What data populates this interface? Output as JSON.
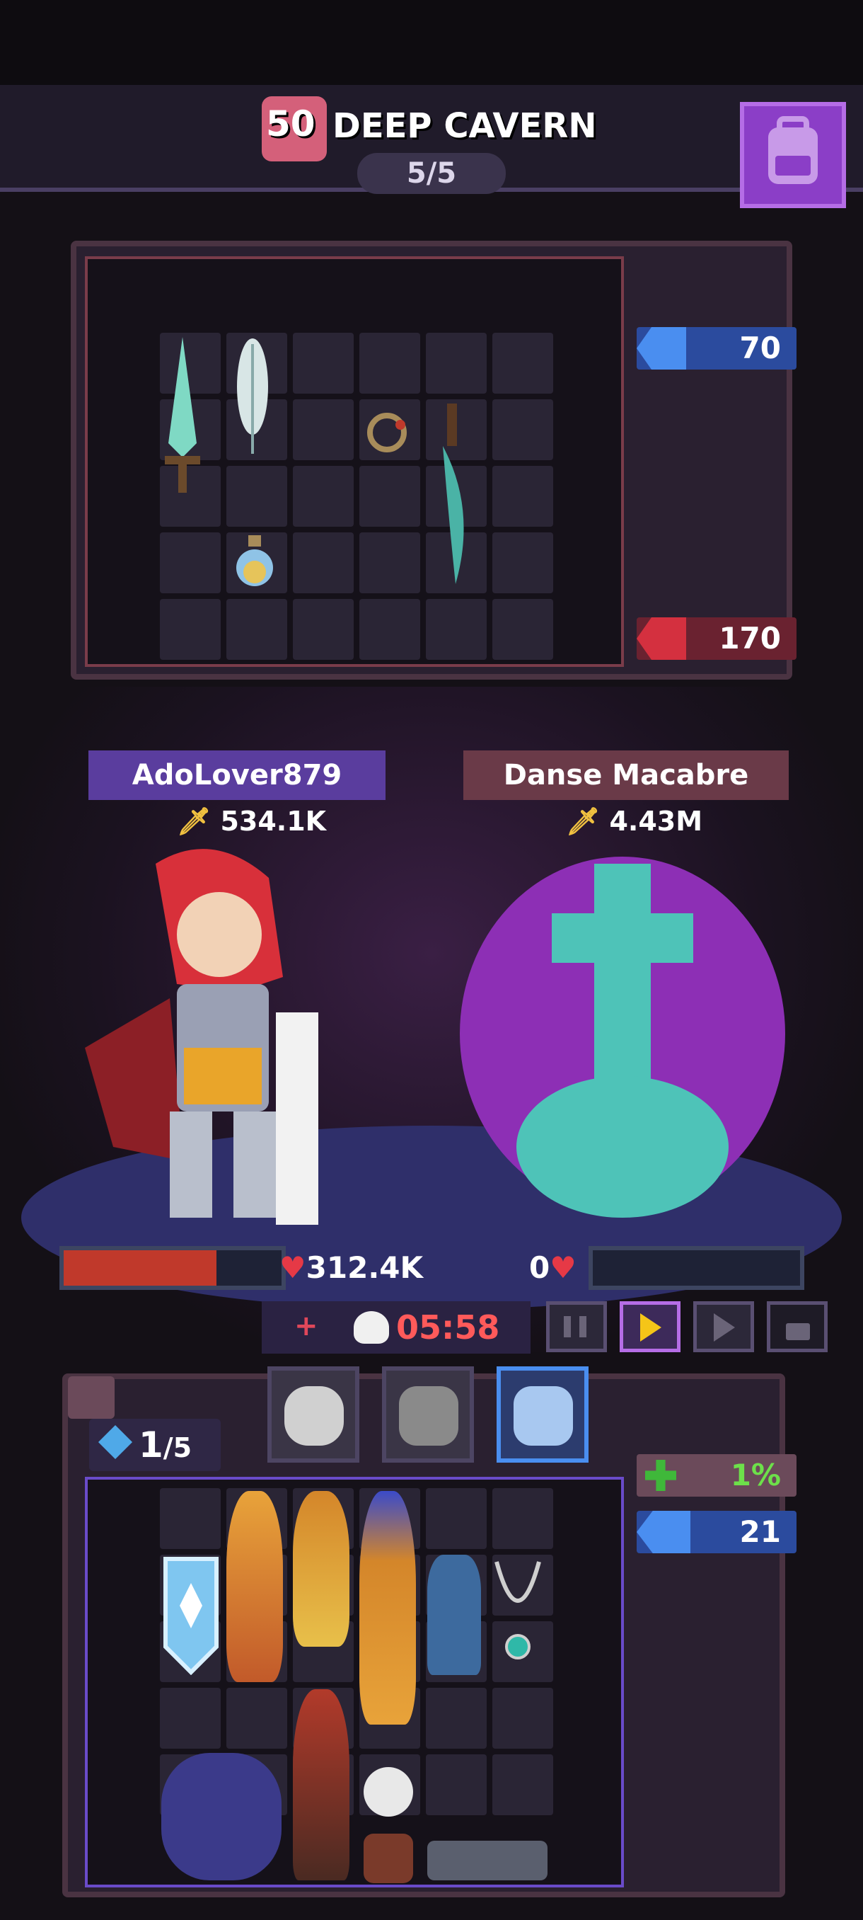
{
  "header": {
    "stage_number": "50",
    "stage_name": "DEEP CAVERN",
    "stage_progress": "5/5",
    "bag_icon": "backpack-icon"
  },
  "enemy_bag": {
    "stat_top": "70",
    "stat_bottom": "170",
    "stat_top_icon": "boot-icon",
    "stat_bottom_icon": "flame-icon"
  },
  "player": {
    "name": "AdoLover879",
    "power": "534.1K",
    "hp": "312.4K",
    "hp_fraction": 0.7
  },
  "enemy": {
    "name": "Danse Macabre",
    "power": "4.43M",
    "hp": "0",
    "hp_fraction": 0
  },
  "timer": {
    "plus": "+",
    "value": "05:58"
  },
  "controls": {
    "pause_icon": "pause-icon",
    "play_icon": "play-icon",
    "fast_icon": "fast-forward-icon",
    "lock_icon": "lock-icon"
  },
  "player_bag": {
    "gems": "1",
    "gems_max": "/5",
    "stat_heal": "1%",
    "stat_crit": "21"
  },
  "colors": {
    "accent_purple": "#8b3ec7",
    "name_plate_player": "#5a3d9e",
    "name_plate_enemy": "#7a3c4a",
    "hp_red": "#c0392b",
    "timer_red": "#ff5a5a",
    "play_yellow": "#f5c518"
  }
}
